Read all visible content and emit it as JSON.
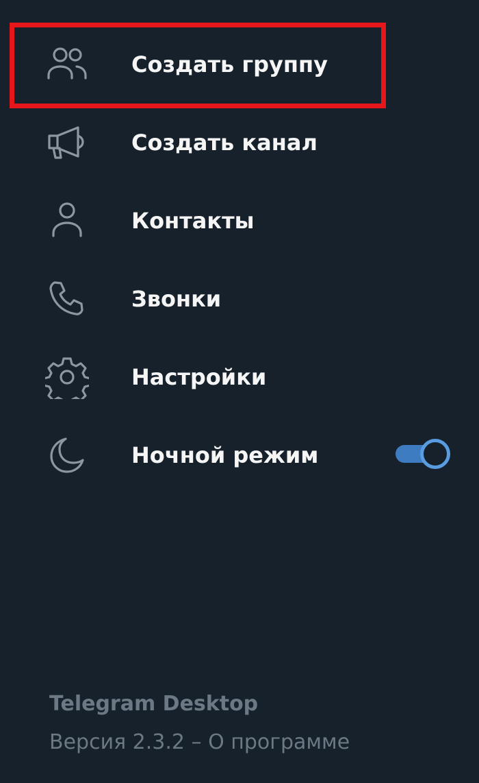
{
  "colors": {
    "background": "#17212b",
    "text_primary": "#f5f5f5",
    "icon": "#8d97a1",
    "footer_text": "#6c7883",
    "highlight": "#e7161b",
    "toggle_track": "#3d7cc0",
    "toggle_knob_border": "#5a9ce0",
    "toggle_knob_fill": "#17212b"
  },
  "menu": {
    "items": [
      {
        "label": "Создать группу",
        "icon": "group-icon"
      },
      {
        "label": "Создать канал",
        "icon": "megaphone-icon"
      },
      {
        "label": "Контакты",
        "icon": "person-icon"
      },
      {
        "label": "Звонки",
        "icon": "phone-icon"
      },
      {
        "label": "Настройки",
        "icon": "gear-icon"
      },
      {
        "label": "Ночной режим",
        "icon": "moon-icon",
        "toggle_on": true
      }
    ]
  },
  "footer": {
    "app_name": "Telegram Desktop",
    "version": "Версия 2.3.2",
    "separator": " – ",
    "about_link": "О программе"
  }
}
